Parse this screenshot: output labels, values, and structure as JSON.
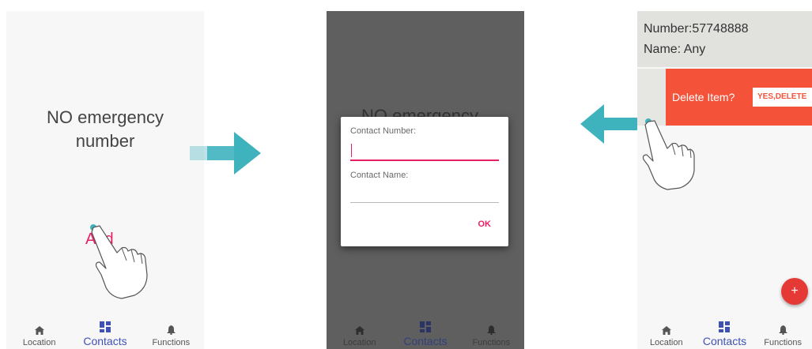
{
  "nav": {
    "location": "Location",
    "contacts": "Contacts",
    "functions": "Functions"
  },
  "screen1": {
    "empty_line1": "NO emergency",
    "empty_line2": "number",
    "add_label": "Add"
  },
  "screen2": {
    "background_text": "NO emergency",
    "dialog": {
      "number_label": "Contact Number:",
      "name_label": "Contact Name:",
      "ok_label": "OK"
    }
  },
  "screen3": {
    "contact": {
      "number_line": "Number:57748888",
      "name_line": "Name: Any"
    },
    "delete_prompt": "Delete Item?",
    "delete_confirm": "YES,DELETE",
    "fab_label": "+"
  },
  "colors": {
    "accent_pink": "#e91e63",
    "nav_active": "#3f51b5",
    "delete_red": "#f4533a",
    "fab_red": "#e53935",
    "arrow_teal": "#3fb3bd"
  },
  "icons": [
    "home-icon",
    "contacts-grid-icon",
    "bell-icon",
    "pointing-hand-icon",
    "right-arrow-icon",
    "left-arrow-icon",
    "plus-icon"
  ]
}
